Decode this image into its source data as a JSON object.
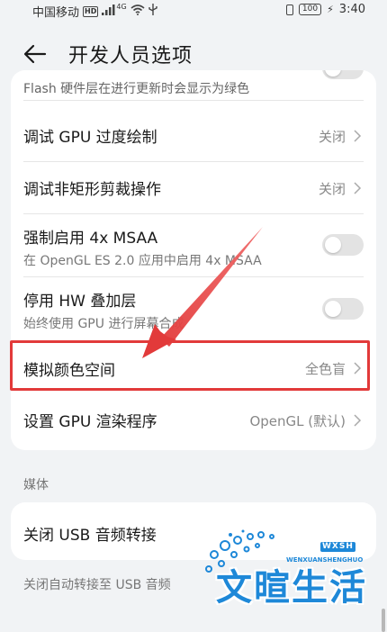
{
  "status_bar": {
    "carrier": "中国移动",
    "hd": "HD",
    "signal": "4G",
    "battery": "100",
    "time": "3:40"
  },
  "header": {
    "title": "开发人员选项"
  },
  "settings": {
    "flash_row": {
      "subtitle": "Flash 硬件层在进行更新时会显示为绿色"
    },
    "gpu_overdraw": {
      "title": "调试 GPU 过度绘制",
      "value": "关闭"
    },
    "non_rect_clip": {
      "title": "调试非矩形剪裁操作",
      "value": "关闭"
    },
    "force_msaa": {
      "title": "强制启用 4x MSAA",
      "subtitle": "在 OpenGL ES 2.0 应用中启用 4x MSAA"
    },
    "disable_hw_overlay": {
      "title": "停用 HW 叠加层",
      "subtitle": "始终使用 GPU 进行屏幕合成"
    },
    "simulate_color_space": {
      "title": "模拟颜色空间",
      "value": "全色盲"
    },
    "gpu_renderer": {
      "title": "设置 GPU 渲染程序",
      "value": "OpenGL (默认)"
    }
  },
  "media_section": {
    "label": "媒体",
    "usb_audio_routing": {
      "title": "关闭 USB 音频转接"
    },
    "note": "关闭自动转接至 USB 音频"
  },
  "watermark": {
    "text": "文暄生活",
    "latin": "WENXUANSHENGHUO",
    "badge": "WXSH"
  },
  "colors": {
    "accent_red": "#e23a3a",
    "watermark_blue": "#1e88d8"
  }
}
